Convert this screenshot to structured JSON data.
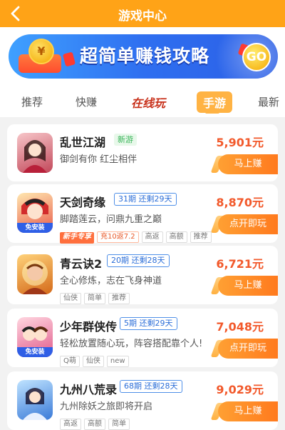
{
  "header": {
    "title": "游戏中心"
  },
  "banner": {
    "title": "超简单赚钱攻略",
    "coin_symbol": "¥",
    "go_label": "GO"
  },
  "tabs": [
    {
      "label": "推荐"
    },
    {
      "label": "快赚"
    },
    {
      "label": "在线玩"
    },
    {
      "label": "手游"
    },
    {
      "label": "最新"
    }
  ],
  "games": [
    {
      "name": "乱世江湖",
      "new_tag": "新游",
      "period": "",
      "desc": "御剑有你 红尘相伴",
      "tags": [],
      "reward": "5,901元",
      "action": "马上赚",
      "icon": "game-portrait-icon",
      "install": ""
    },
    {
      "name": "天剑奇缘",
      "new_tag": "",
      "period": "31期 还剩29天",
      "desc": "脚踏莲云，问鼎九重之巅",
      "tags": [
        "新手专享",
        "充10返7.2",
        "高返",
        "高额",
        "推荐"
      ],
      "reward": "8,870元",
      "action": "点开即玩",
      "icon": "game-portrait-icon",
      "install": "免安装"
    },
    {
      "name": "青云诀2",
      "new_tag": "",
      "period": "20期 还剩28天",
      "desc": "全心修炼，志在飞身神道",
      "tags": [
        "仙侠",
        "简单",
        "推荐"
      ],
      "reward": "6,721元",
      "action": "马上赚",
      "icon": "game-portrait-icon",
      "install": ""
    },
    {
      "name": "少年群侠传",
      "new_tag": "",
      "period": "5期 还剩29天",
      "desc": "轻松放置随心玩，阵容搭配靠个人!",
      "tags": [
        "Q萌",
        "仙侠",
        "new"
      ],
      "reward": "7,048元",
      "action": "点开即玩",
      "icon": "game-portrait-icon",
      "install": "免安装"
    },
    {
      "name": "九州八荒录",
      "new_tag": "",
      "period": "68期 还剩28天",
      "desc": "九州除妖之旅即将开启",
      "tags": [
        "高返",
        "高额",
        "简单"
      ],
      "reward": "9,029元",
      "action": "马上赚",
      "icon": "game-portrait-icon",
      "install": ""
    }
  ],
  "colors": {
    "header": "#ffa317",
    "accent": "#f2592b",
    "period_border": "#4f8fe8"
  }
}
